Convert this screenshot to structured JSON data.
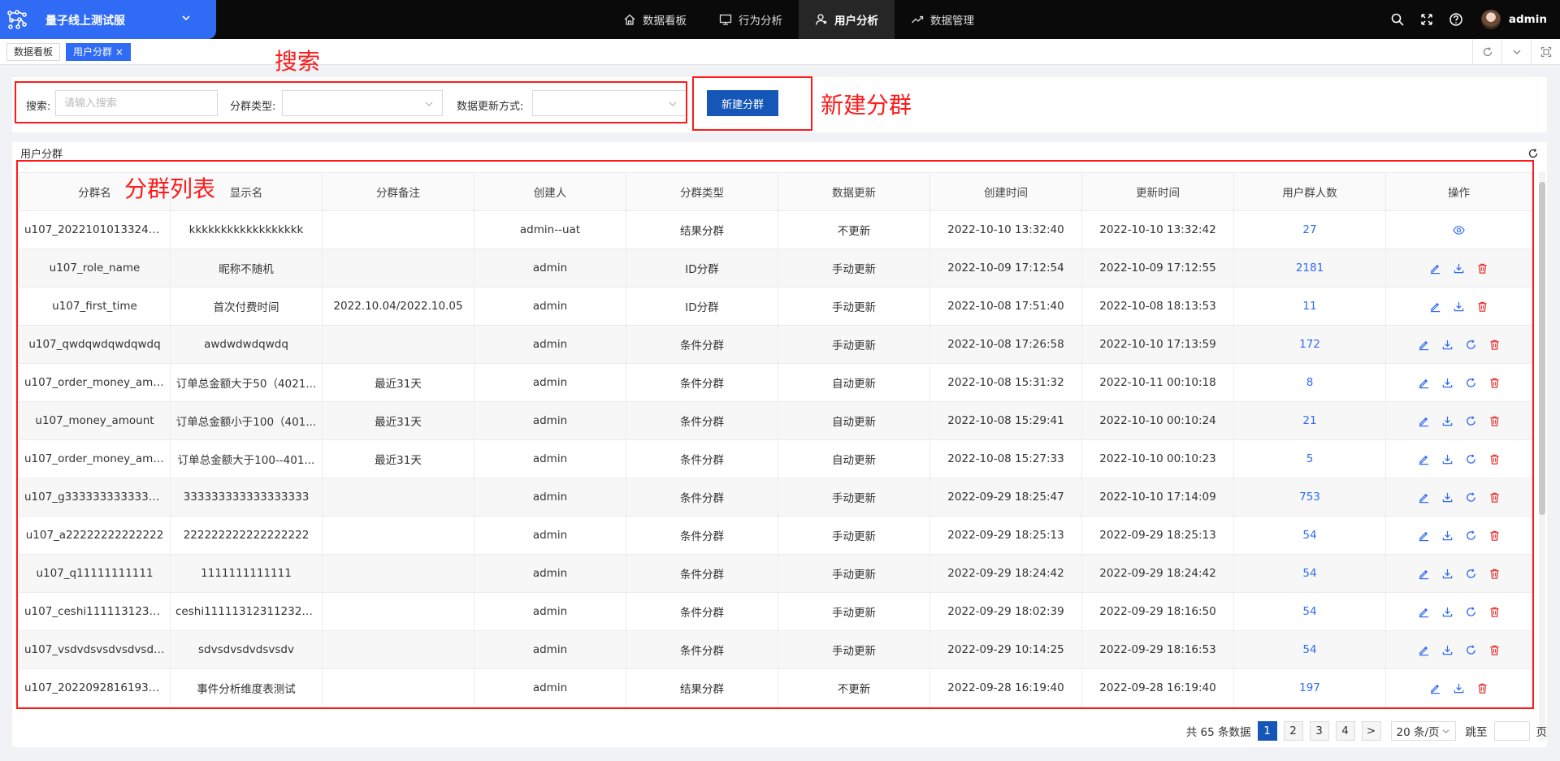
{
  "app": {
    "title": "量子线上测试服",
    "user": "admin"
  },
  "nav": [
    {
      "label": "数据看板",
      "icon": "home-icon"
    },
    {
      "label": "行为分析",
      "icon": "monitor-icon"
    },
    {
      "label": "用户分析",
      "icon": "user-icon",
      "active": true
    },
    {
      "label": "数据管理",
      "icon": "trend-icon"
    }
  ],
  "tabs": [
    {
      "label": "数据看板"
    },
    {
      "label": "用户分群",
      "close": "×",
      "active": true
    }
  ],
  "filters": {
    "search_label": "搜索:",
    "search_placeholder": "请输入搜索",
    "type_label": "分群类型:",
    "update_label": "数据更新方式:",
    "new_button": "新建分群"
  },
  "annotations": {
    "search": "搜索",
    "new_group": "新建分群",
    "group_list": "分群列表"
  },
  "table": {
    "card_title": "用户分群",
    "columns": [
      "分群名",
      "显示名",
      "分群备注",
      "创建人",
      "分群类型",
      "数据更新",
      "创建时间",
      "更新时间",
      "用户群人数",
      "操作"
    ],
    "rows": [
      {
        "name": "u107_2022101013324064...",
        "display": "kkkkkkkkkkkkkkkkkk",
        "note": "",
        "creator": "admin--uat",
        "type": "结果分群",
        "update": "不更新",
        "created": "2022-10-10 13:32:40",
        "updated": "2022-10-10 13:32:42",
        "count": "27",
        "ops": [
          "view-icon"
        ]
      },
      {
        "name": "u107_role_name",
        "display": "昵称不随机",
        "note": "",
        "creator": "admin",
        "type": "ID分群",
        "update": "手动更新",
        "created": "2022-10-09 17:12:54",
        "updated": "2022-10-09 17:12:55",
        "count": "2181",
        "ops": [
          "edit-icon",
          "download-icon",
          "delete-icon"
        ]
      },
      {
        "name": "u107_first_time",
        "display": "首次付费时间",
        "note": "2022.10.04/2022.10.05",
        "creator": "admin",
        "type": "ID分群",
        "update": "手动更新",
        "created": "2022-10-08 17:51:40",
        "updated": "2022-10-08 18:13:53",
        "count": "11",
        "ops": [
          "edit-icon",
          "download-icon",
          "delete-icon"
        ]
      },
      {
        "name": "u107_qwdqwdqwdqwdq",
        "display": "awdwdwdqwdq",
        "note": "",
        "creator": "admin",
        "type": "条件分群",
        "update": "手动更新",
        "created": "2022-10-08 17:26:58",
        "updated": "2022-10-10 17:13:59",
        "count": "172",
        "ops": [
          "edit-icon",
          "download-icon",
          "refresh-icon",
          "delete-icon"
        ]
      },
      {
        "name": "u107_order_money_amou...",
        "display": "订单总金额大于50（4021...",
        "note": "最近31天",
        "creator": "admin",
        "type": "条件分群",
        "update": "自动更新",
        "created": "2022-10-08 15:31:32",
        "updated": "2022-10-11 00:10:18",
        "count": "8",
        "ops": [
          "edit-icon",
          "download-icon",
          "refresh-icon",
          "delete-icon"
        ]
      },
      {
        "name": "u107_money_amount",
        "display": "订单总金额小于100（401...",
        "note": "最近31天",
        "creator": "admin",
        "type": "条件分群",
        "update": "自动更新",
        "created": "2022-10-08 15:29:41",
        "updated": "2022-10-10 00:10:24",
        "count": "21",
        "ops": [
          "edit-icon",
          "download-icon",
          "refresh-icon",
          "delete-icon"
        ]
      },
      {
        "name": "u107_order_money_amou...",
        "display": "订单总金额大于100--401...",
        "note": "最近31天",
        "creator": "admin",
        "type": "条件分群",
        "update": "自动更新",
        "created": "2022-10-08 15:27:33",
        "updated": "2022-10-10 00:10:23",
        "count": "5",
        "ops": [
          "edit-icon",
          "download-icon",
          "refresh-icon",
          "delete-icon"
        ]
      },
      {
        "name": "u107_g333333333333333",
        "display": "333333333333333333",
        "note": "",
        "creator": "admin",
        "type": "条件分群",
        "update": "手动更新",
        "created": "2022-09-29 18:25:47",
        "updated": "2022-10-10 17:14:09",
        "count": "753",
        "ops": [
          "edit-icon",
          "download-icon",
          "refresh-icon",
          "delete-icon"
        ]
      },
      {
        "name": "u107_a22222222222222",
        "display": "222222222222222222",
        "note": "",
        "creator": "admin",
        "type": "条件分群",
        "update": "手动更新",
        "created": "2022-09-29 18:25:13",
        "updated": "2022-09-29 18:25:13",
        "count": "54",
        "ops": [
          "edit-icon",
          "download-icon",
          "refresh-icon",
          "delete-icon"
        ]
      },
      {
        "name": "u107_q11111111111",
        "display": "1111111111111",
        "note": "",
        "creator": "admin",
        "type": "条件分群",
        "update": "手动更新",
        "created": "2022-09-29 18:24:42",
        "updated": "2022-09-29 18:24:42",
        "count": "54",
        "ops": [
          "edit-icon",
          "download-icon",
          "refresh-icon",
          "delete-icon"
        ]
      },
      {
        "name": "u107_ceshi111113123112...",
        "display": "ceshi11111312311232132...",
        "note": "",
        "creator": "admin",
        "type": "条件分群",
        "update": "手动更新",
        "created": "2022-09-29 18:02:39",
        "updated": "2022-09-29 18:16:50",
        "count": "54",
        "ops": [
          "edit-icon",
          "download-icon",
          "refresh-icon",
          "delete-icon"
        ]
      },
      {
        "name": "u107_vsdvdsvsdvsdvsdvsd",
        "display": "sdvsdvsdvdsvsdv",
        "note": "",
        "creator": "admin",
        "type": "条件分群",
        "update": "手动更新",
        "created": "2022-09-29 10:14:25",
        "updated": "2022-09-29 18:16:53",
        "count": "54",
        "ops": [
          "edit-icon",
          "download-icon",
          "refresh-icon",
          "delete-icon"
        ]
      },
      {
        "name": "u107_2022092816193861...",
        "display": "事件分析维度表测试",
        "note": "",
        "creator": "admin",
        "type": "结果分群",
        "update": "不更新",
        "created": "2022-09-28 16:19:40",
        "updated": "2022-09-28 16:19:40",
        "count": "197",
        "ops": [
          "edit-icon",
          "download-icon",
          "delete-icon"
        ]
      }
    ]
  },
  "pagination": {
    "total_text": "共 65 条数据",
    "pages": [
      "1",
      "2",
      "3",
      "4"
    ],
    "current": "1",
    "next": ">",
    "page_size": "20 条/页",
    "goto_label": "跳至",
    "page_suffix": "页"
  },
  "colors": {
    "primary": "#2f6bf5",
    "button": "#1556b8",
    "annotation": "#ff1a1a",
    "danger": "#e53935"
  }
}
